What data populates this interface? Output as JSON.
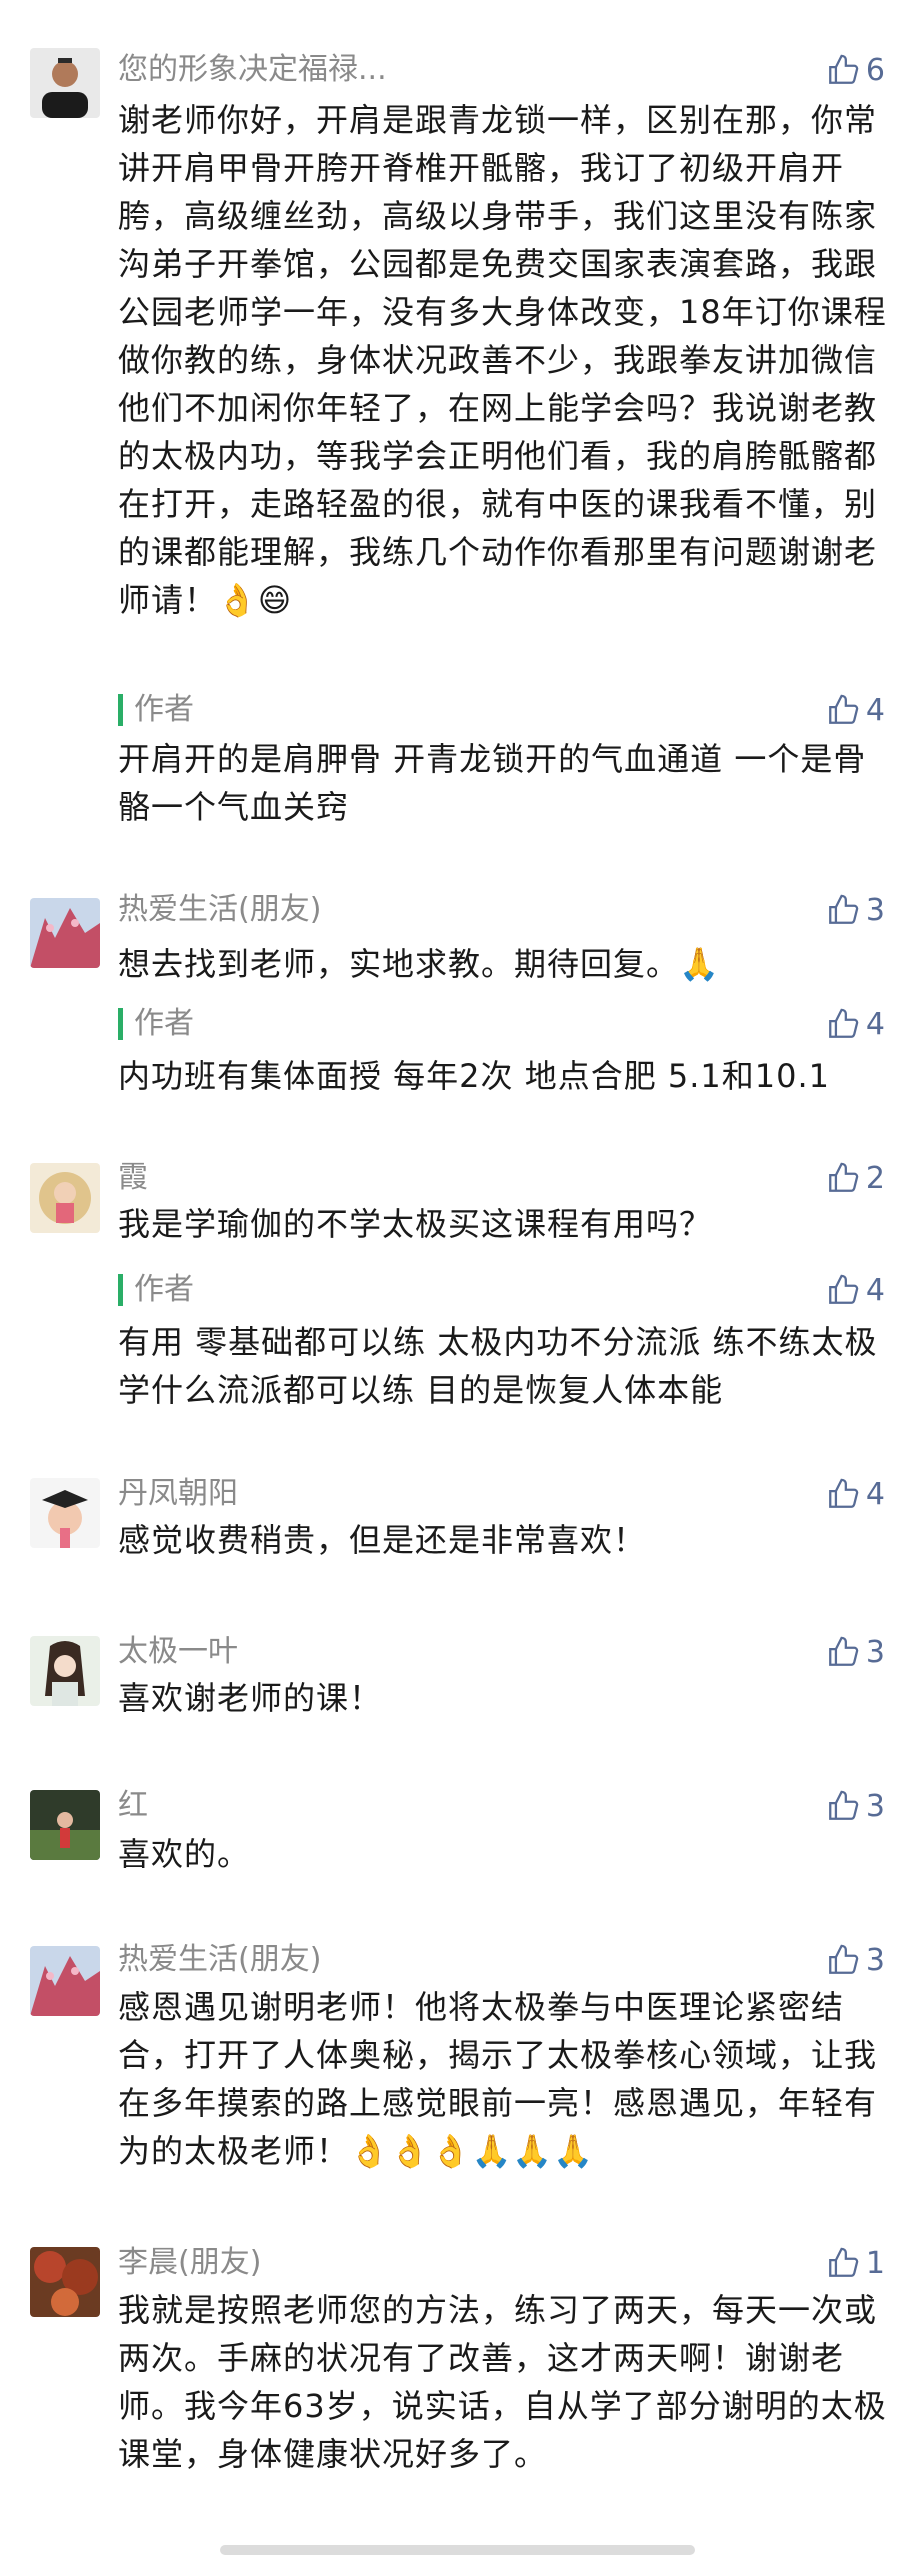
{
  "comments": [
    {
      "name": "您的形象决定福禄...",
      "likes": "6",
      "text": "谢老师你好，开肩是跟青龙锁一样，区别在那，你常讲开肩甲骨开胯开脊椎开骶髂，我订了初级开肩开胯，高级缠丝劲，高级以身带手，我们这里没有陈家沟弟子开拳馆，公园都是免费交国家表演套路，我跟公园老师学一年，没有多大身体改变，18年订你课程做你教的练，身体状况政善不少，我跟拳友讲加微信他们不加闲你年轻了，在网上能学会吗？我说谢老教的太极内功，等我学会正明他们看，我的肩胯骶髂都在打开，走路轻盈的很，就有中医的课我看不懂，别的课都能理解，我练几个动作你看那里有问题谢谢老师请！👌😄",
      "reply": {
        "author": "作者",
        "likes": "4",
        "text": "开肩开的是肩胛骨 开青龙锁开的气血通道 一个是骨骼一个气血关窍"
      }
    },
    {
      "name": "热爱生活(朋友)",
      "likes": "3",
      "text": "想去找到老师，实地求教。期待回复。🙏",
      "reply": {
        "author": "作者",
        "likes": "4",
        "text": "内功班有集体面授 每年2次 地点合肥  5.1和10.1"
      }
    },
    {
      "name": "霞",
      "likes": "2",
      "text": "我是学瑜伽的不学太极买这课程有用吗？",
      "reply": {
        "author": "作者",
        "likes": "4",
        "text": "有用 零基础都可以练 太极内功不分流派 练不练太极 学什么流派都可以练 目的是恢复人体本能"
      }
    },
    {
      "name": "丹凤朝阳",
      "likes": "4",
      "text": "感觉收费稍贵，但是还是非常喜欢！"
    },
    {
      "name": "太极一叶",
      "likes": "3",
      "text": "喜欢谢老师的课！"
    },
    {
      "name": "红",
      "likes": "3",
      "text": "喜欢的。"
    },
    {
      "name": "热爱生活(朋友)",
      "likes": "3",
      "text": "感恩遇见谢明老师！他将太极拳与中医理论紧密结合，打开了人体奥秘，揭示了太极拳核心领域，让我在多年摸索的路上感觉眼前一亮！感恩遇见，年轻有为的太极老师！👌👌👌🙏🙏🙏"
    },
    {
      "name": "李晨(朋友)",
      "likes": "1",
      "text": "我就是按照老师您的方法，练习了两天，每天一次或两次。手麻的状况有了改善，这才两天啊！谢谢老师。我今年63岁，说实话，自从学了部分谢明的太极课堂，身体健康状况好多了。"
    }
  ],
  "icons": {
    "like": "thumbs-up-icon"
  },
  "colors": {
    "like": "#576b95",
    "author_bar": "#2aae67",
    "name": "#8a8a8a"
  }
}
